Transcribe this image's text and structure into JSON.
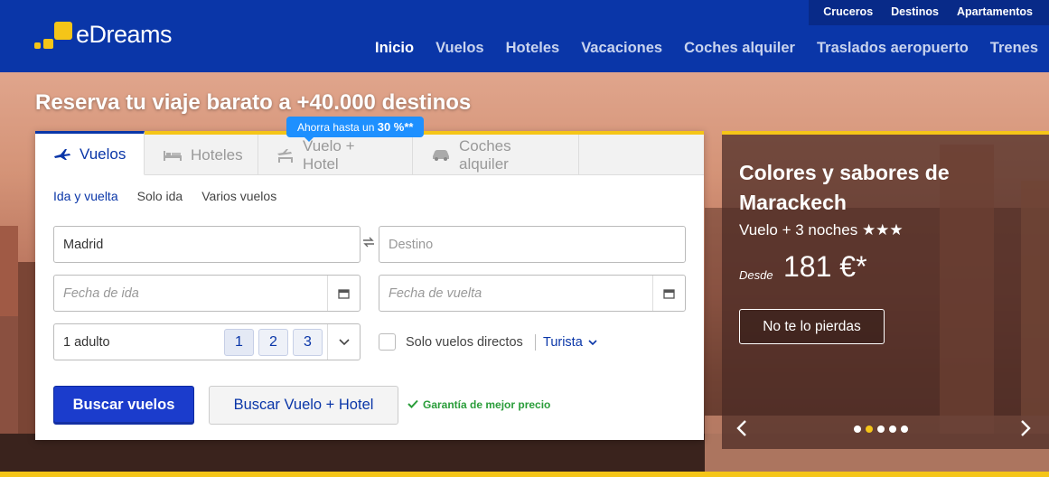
{
  "header": {
    "logo_text": "eDreams",
    "top_links": [
      "Cruceros",
      "Destinos",
      "Apartamentos"
    ],
    "nav": [
      "Inicio",
      "Vuelos",
      "Hoteles",
      "Vacaciones",
      "Coches alquiler",
      "Traslados aeropuerto",
      "Trenes"
    ],
    "active_nav": "Inicio"
  },
  "hero": {
    "tagline": "Reserva tu viaje barato a +40.000 destinos"
  },
  "search": {
    "promo_prefix": "Ahorra hasta un ",
    "promo_value": "30 %**",
    "tabs": [
      {
        "label": "Vuelos",
        "icon": "plane-icon"
      },
      {
        "label": "Hoteles",
        "icon": "bed-icon"
      },
      {
        "label": "Vuelo + Hotel",
        "icon": "plane-hotel-icon"
      },
      {
        "label": "Coches alquiler",
        "icon": "car-icon"
      }
    ],
    "trip_types": [
      "Ida y vuelta",
      "Solo ida",
      "Varios vuelos"
    ],
    "origin_value": "Madrid",
    "destination_placeholder": "Destino",
    "depart_placeholder": "Fecha de ida",
    "return_placeholder": "Fecha de vuelta",
    "passengers_label": "1 adulto",
    "passenger_quick": [
      "1",
      "2",
      "3"
    ],
    "direct_label": "Solo vuelos directos",
    "class_value": "Turista",
    "search_flights_label": "Buscar vuelos",
    "search_package_label": "Buscar Vuelo + Hotel",
    "guarantee": "Garantía de mejor precio"
  },
  "promo_panel": {
    "title": "Colores y sabores de Marackech",
    "subtitle": "Vuelo + 3 noches ★★★",
    "from_label": "Desde",
    "price": "181 €*",
    "cta": "No te lo pierdas",
    "slide_count": 5,
    "active_slide": 2
  },
  "colors": {
    "brand_blue": "#0a36a8",
    "accent_yellow": "#f5c518",
    "promo_badge": "#1e90ff",
    "guarantee_green": "#2a9d3a"
  }
}
